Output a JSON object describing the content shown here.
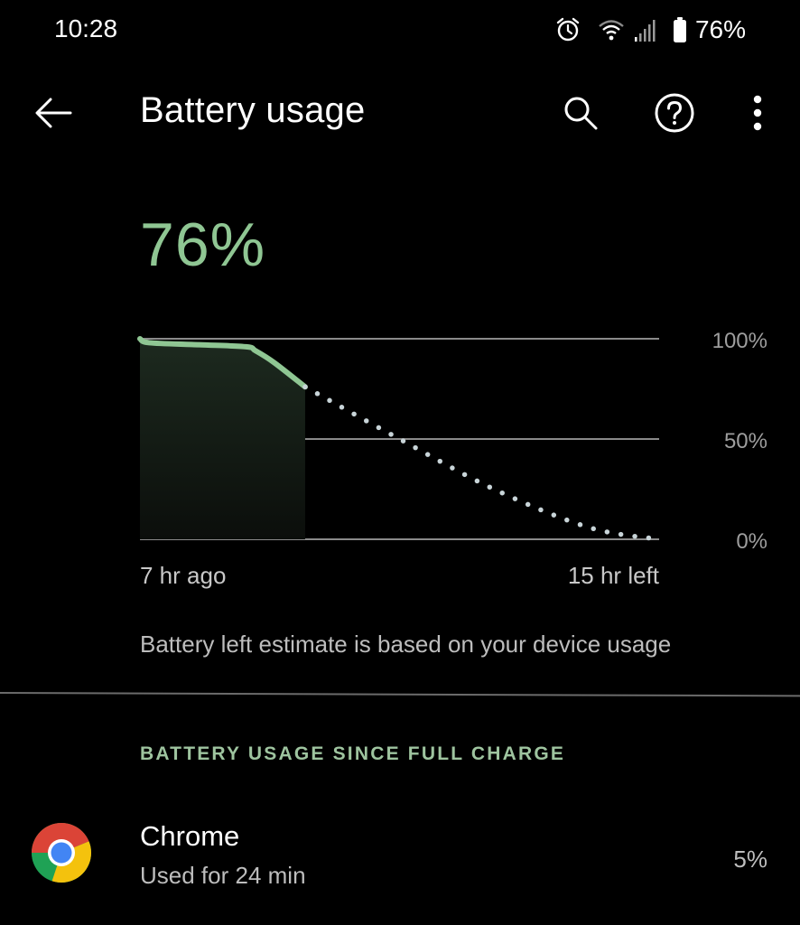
{
  "status_bar": {
    "time": "10:28",
    "icons": [
      "alarm-icon",
      "wifi-icon",
      "cell-signal-icon",
      "battery-icon"
    ],
    "battery_percent": "76%"
  },
  "app_bar": {
    "title": "Battery usage",
    "back_icon": "arrow-back-icon",
    "actions": [
      "search-icon",
      "help-icon",
      "more-vert-icon"
    ]
  },
  "battery": {
    "level": "76%"
  },
  "chart_data": {
    "type": "line",
    "title": "",
    "xlabel": "",
    "ylabel": "",
    "x_start_label": "7 hr ago",
    "x_end_label": "15 hr left",
    "yticks": [
      "100%",
      "50%",
      "0%"
    ],
    "ylim": [
      0,
      100
    ],
    "x_range_hours": [
      -7,
      15
    ],
    "grid": true,
    "series": [
      {
        "name": "History",
        "style": "solid",
        "color": "#8fc693",
        "points": [
          {
            "hours": -7.0,
            "percent": 100
          },
          {
            "hours": -6.6,
            "percent": 98
          },
          {
            "hours": -4.5,
            "percent": 97
          },
          {
            "hours": -2.5,
            "percent": 96
          },
          {
            "hours": -2.1,
            "percent": 94
          },
          {
            "hours": -1.3,
            "percent": 88
          },
          {
            "hours": 0.0,
            "percent": 76
          }
        ]
      },
      {
        "name": "Projection",
        "style": "dotted",
        "color": "#c8d4d8",
        "points": [
          {
            "hours": 0.0,
            "percent": 76
          },
          {
            "hours": 4.0,
            "percent": 50
          },
          {
            "hours": 8.0,
            "percent": 25
          },
          {
            "hours": 12.0,
            "percent": 6
          },
          {
            "hours": 15.0,
            "percent": 0
          }
        ]
      }
    ]
  },
  "estimate_note": "Battery left estimate is based on your device usage",
  "section": {
    "header": "BATTERY USAGE SINCE FULL CHARGE"
  },
  "apps": [
    {
      "name": "Chrome",
      "icon": "chrome-icon",
      "usage": "Used for 24 min",
      "percent": "5%"
    }
  ],
  "colors": {
    "accent": "#8fc693",
    "section_header": "#9ec49f",
    "grid": "#8a8a8a",
    "projection": "#c8d4d8",
    "background": "#000000"
  }
}
